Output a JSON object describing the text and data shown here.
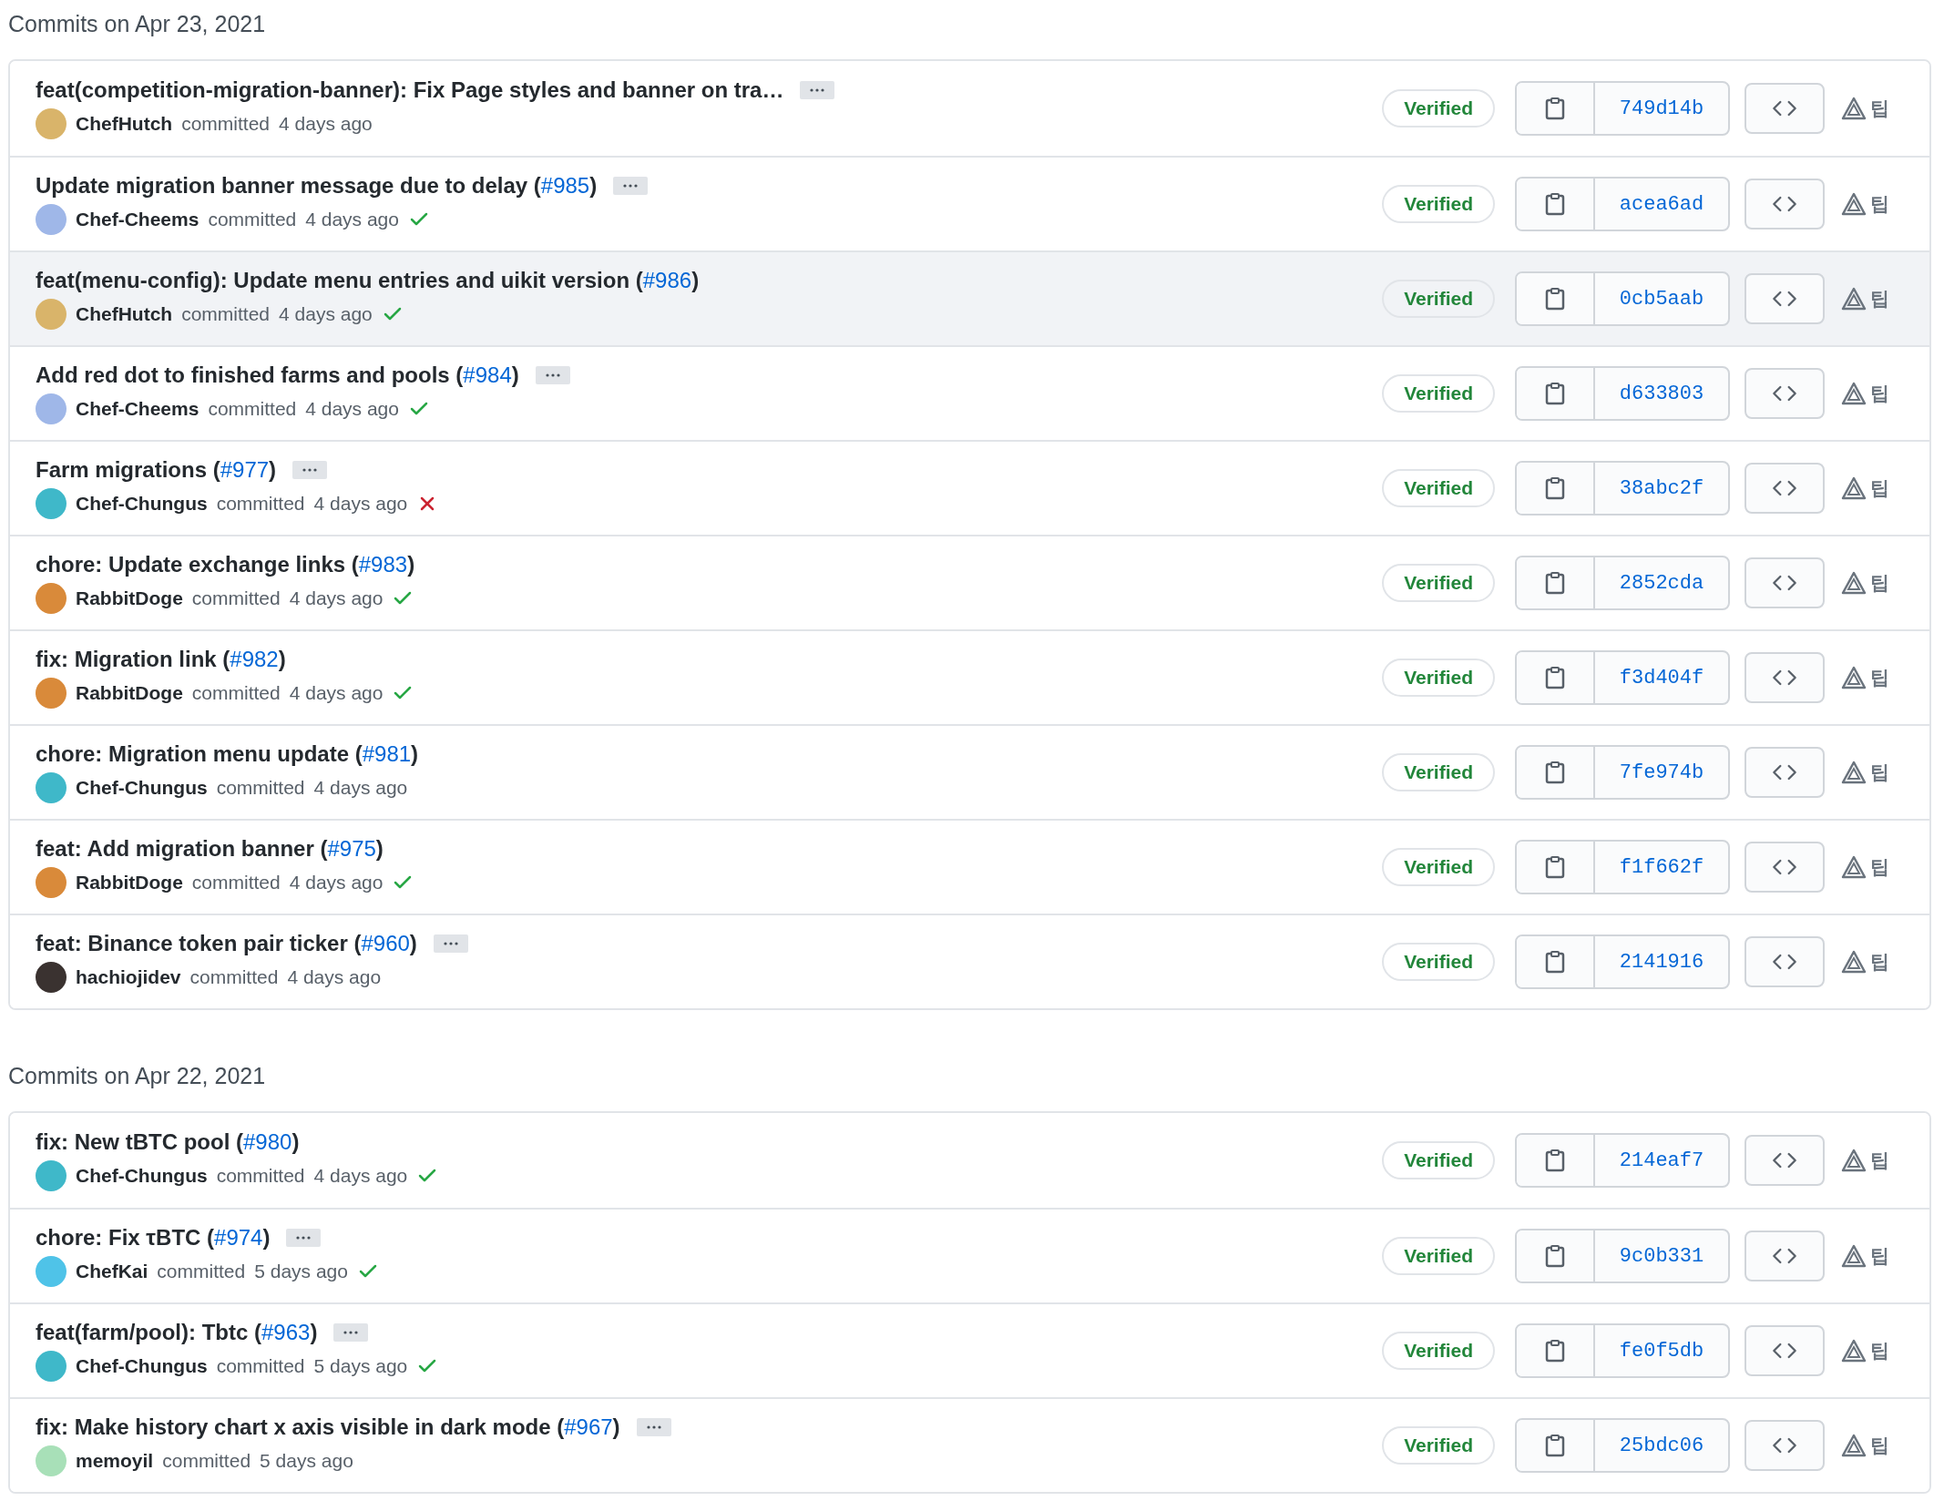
{
  "groups": [
    {
      "date": "Commits on Apr 23, 2021",
      "commits": [
        {
          "title": "feat(competition-migration-banner): Fix Page styles and banner on tra…",
          "expandable": true,
          "author": "ChefHutch",
          "color": "#d9b46a",
          "action": "committed",
          "time": "4 days ago",
          "badge": "Verified",
          "sha": "749d14b",
          "highlighted": false,
          "tip": "팁"
        },
        {
          "title": "Update migration banner message due to delay (",
          "pr": "#985",
          "title_end": ")",
          "expandable": true,
          "author": "Chef-Cheems",
          "color": "#9fb7e8",
          "action": "committed",
          "time": "4 days ago",
          "checks_passed": true,
          "badge": "Verified",
          "sha": "acea6ad",
          "highlighted": false,
          "tip": "팁"
        },
        {
          "title": "feat(menu-config): Update menu entries and uikit version (",
          "pr": "#986",
          "title_end": ")",
          "expandable": false,
          "author": "ChefHutch",
          "color": "#d9b46a",
          "action": "committed",
          "time": "4 days ago",
          "checks_passed": true,
          "badge": "Verified",
          "sha": "0cb5aab",
          "highlighted": true,
          "tip": "팁"
        },
        {
          "title": "Add red dot to finished farms and pools (",
          "pr": "#984",
          "title_end": ")",
          "expandable": true,
          "author": "Chef-Cheems",
          "color": "#9fb7e8",
          "action": "committed",
          "time": "4 days ago",
          "checks_passed": true,
          "badge": "Verified",
          "sha": "d633803",
          "highlighted": false,
          "tip": "팁"
        },
        {
          "title": "Farm migrations (",
          "pr": "#977",
          "title_end": ")",
          "expandable": true,
          "author": "Chef-Chungus",
          "color": "#3fb8c9",
          "action": "committed",
          "time": "4 days ago",
          "checks_passed": false,
          "badge": "Verified",
          "sha": "38abc2f",
          "highlighted": false,
          "tip": "팁"
        },
        {
          "title": "chore: Update exchange links (",
          "pr": "#983",
          "title_end": ")",
          "expandable": false,
          "author": "RabbitDoge",
          "color": "#d98a3a",
          "action": "committed",
          "time": "4 days ago",
          "checks_passed": true,
          "badge": "Verified",
          "sha": "2852cda",
          "highlighted": false,
          "tip": "팁"
        },
        {
          "title": "fix: Migration link (",
          "pr": "#982",
          "title_end": ")",
          "expandable": false,
          "author": "RabbitDoge",
          "color": "#d98a3a",
          "action": "committed",
          "time": "4 days ago",
          "checks_passed": true,
          "badge": "Verified",
          "sha": "f3d404f",
          "highlighted": false,
          "tip": "팁"
        },
        {
          "title": "chore: Migration menu update (",
          "pr": "#981",
          "title_end": ")",
          "expandable": false,
          "author": "Chef-Chungus",
          "color": "#3fb8c9",
          "action": "committed",
          "time": "4 days ago",
          "badge": "Verified",
          "sha": "7fe974b",
          "highlighted": false,
          "tip": "팁"
        },
        {
          "title": "feat: Add migration banner (",
          "pr": "#975",
          "title_end": ")",
          "expandable": false,
          "author": "RabbitDoge",
          "color": "#d98a3a",
          "action": "committed",
          "time": "4 days ago",
          "checks_passed": true,
          "badge": "Verified",
          "sha": "f1f662f",
          "highlighted": false,
          "tip": "팁"
        },
        {
          "title": "feat: Binance token pair ticker (",
          "pr": "#960",
          "title_end": ")",
          "expandable": true,
          "author": "hachiojidev",
          "color": "#3a3230",
          "action": "committed",
          "time": "4 days ago",
          "badge": "Verified",
          "sha": "2141916",
          "highlighted": false,
          "tip": "팁"
        }
      ]
    },
    {
      "date": "Commits on Apr 22, 2021",
      "commits": [
        {
          "title": "fix: New tBTC pool (",
          "pr": "#980",
          "title_end": ")",
          "expandable": false,
          "author": "Chef-Chungus",
          "color": "#3fb8c9",
          "action": "committed",
          "time": "4 days ago",
          "checks_passed": true,
          "badge": "Verified",
          "sha": "214eaf7",
          "highlighted": false,
          "tip": "팁"
        },
        {
          "title": "chore: Fix τBTC (",
          "pr": "#974",
          "title_end": ")",
          "expandable": true,
          "author": "ChefKai",
          "color": "#4fc3e8",
          "action": "committed",
          "time": "5 days ago",
          "checks_passed": true,
          "badge": "Verified",
          "sha": "9c0b331",
          "highlighted": false,
          "tip": "팁"
        },
        {
          "title": "feat(farm/pool): Tbtc (",
          "pr": "#963",
          "title_end": ")",
          "expandable": true,
          "author": "Chef-Chungus",
          "color": "#3fb8c9",
          "action": "committed",
          "time": "5 days ago",
          "checks_passed": true,
          "badge": "Verified",
          "sha": "fe0f5db",
          "highlighted": false,
          "tip": "팁"
        },
        {
          "title": "fix: Make history chart x axis visible in dark mode (",
          "pr": "#967",
          "title_end": ")",
          "expandable": true,
          "author": "memoyil",
          "color": "#a8e0b8",
          "action": "committed",
          "time": "5 days ago",
          "badge": "Verified",
          "sha": "25bdc06",
          "highlighted": false,
          "tip": "팁"
        }
      ]
    }
  ]
}
